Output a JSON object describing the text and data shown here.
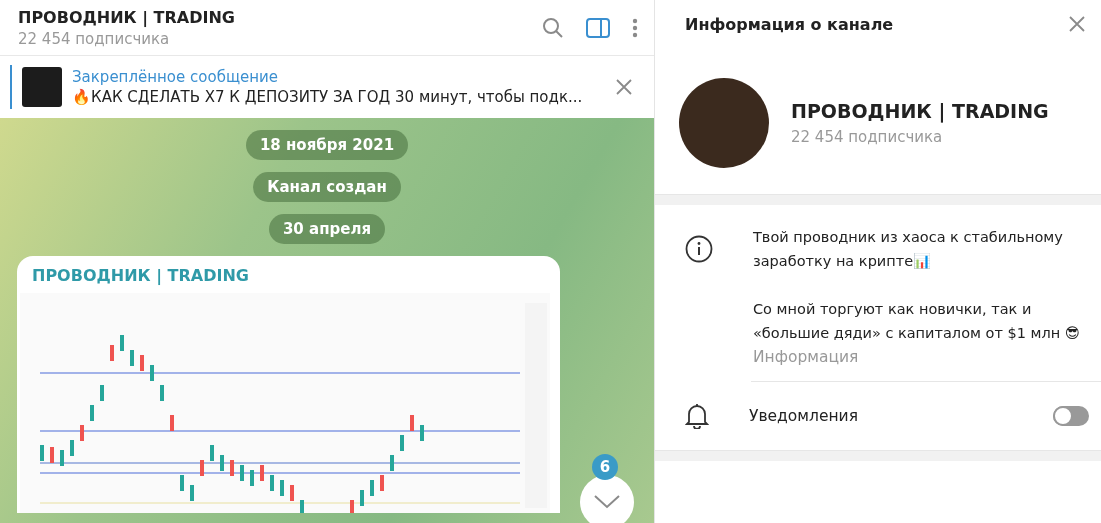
{
  "chat_header": {
    "title": "ПРОВОДНИК | TRADING",
    "subtitle": "22 454 подписчика",
    "panel_toggle": {
      "selected": true
    }
  },
  "pinned": {
    "label": "Закреплённое сообщение",
    "text": "🔥КАК СДЕЛАТЬ Х7 К ДЕПОЗИТУ ЗА ГОД   30 минут, чтобы подк..."
  },
  "service_messages": [
    {
      "text": "18 ноября 2021"
    },
    {
      "text": "Канал создан"
    },
    {
      "text": "30 апреля"
    }
  ],
  "message": {
    "author": "ПРОВОДНИК | TRADING"
  },
  "scroll_down": {
    "unread": "6"
  },
  "info_panel": {
    "title": "Информация о канале",
    "name": "ПРОВОДНИК | TRADING",
    "subtitle": "22 454 подписчика",
    "description": [
      "Твой проводник из хаоса к стабильному заработку на крипте📊",
      "Со мной торгуют как новички, так и «большие дяди» с капиталом от $1 млн 😎"
    ],
    "description_label": "Информация",
    "notifications": {
      "label": "Уведомления",
      "on": false
    }
  }
}
